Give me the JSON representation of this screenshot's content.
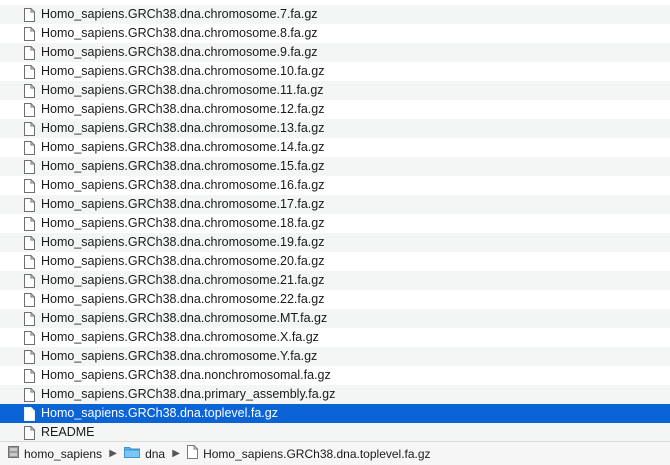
{
  "files": [
    {
      "name": "",
      "partial": true
    },
    {
      "name": "Homo_sapiens.GRCh38.dna.chromosome.7.fa.gz"
    },
    {
      "name": "Homo_sapiens.GRCh38.dna.chromosome.8.fa.gz"
    },
    {
      "name": "Homo_sapiens.GRCh38.dna.chromosome.9.fa.gz"
    },
    {
      "name": "Homo_sapiens.GRCh38.dna.chromosome.10.fa.gz"
    },
    {
      "name": "Homo_sapiens.GRCh38.dna.chromosome.11.fa.gz"
    },
    {
      "name": "Homo_sapiens.GRCh38.dna.chromosome.12.fa.gz"
    },
    {
      "name": "Homo_sapiens.GRCh38.dna.chromosome.13.fa.gz"
    },
    {
      "name": "Homo_sapiens.GRCh38.dna.chromosome.14.fa.gz"
    },
    {
      "name": "Homo_sapiens.GRCh38.dna.chromosome.15.fa.gz"
    },
    {
      "name": "Homo_sapiens.GRCh38.dna.chromosome.16.fa.gz"
    },
    {
      "name": "Homo_sapiens.GRCh38.dna.chromosome.17.fa.gz"
    },
    {
      "name": "Homo_sapiens.GRCh38.dna.chromosome.18.fa.gz"
    },
    {
      "name": "Homo_sapiens.GRCh38.dna.chromosome.19.fa.gz"
    },
    {
      "name": "Homo_sapiens.GRCh38.dna.chromosome.20.fa.gz"
    },
    {
      "name": "Homo_sapiens.GRCh38.dna.chromosome.21.fa.gz"
    },
    {
      "name": "Homo_sapiens.GRCh38.dna.chromosome.22.fa.gz"
    },
    {
      "name": "Homo_sapiens.GRCh38.dna.chromosome.MT.fa.gz"
    },
    {
      "name": "Homo_sapiens.GRCh38.dna.chromosome.X.fa.gz"
    },
    {
      "name": "Homo_sapiens.GRCh38.dna.chromosome.Y.fa.gz"
    },
    {
      "name": "Homo_sapiens.GRCh38.dna.nonchromosomal.fa.gz"
    },
    {
      "name": "Homo_sapiens.GRCh38.dna.primary_assembly.fa.gz"
    },
    {
      "name": "Homo_sapiens.GRCh38.dna.toplevel.fa.gz",
      "selected": true
    },
    {
      "name": "README"
    }
  ],
  "path_bar": {
    "items": [
      {
        "label": "homo_sapiens",
        "icon": "drive-icon"
      },
      {
        "label": "dna",
        "icon": "folder-icon"
      },
      {
        "label": "Homo_sapiens.GRCh38.dna.toplevel.fa.gz",
        "icon": "document-icon"
      }
    ],
    "separator": "▶"
  },
  "colors": {
    "selection": "#0b64d5",
    "folder": "#5ab4f0",
    "stripe": "#f4f5f5"
  }
}
